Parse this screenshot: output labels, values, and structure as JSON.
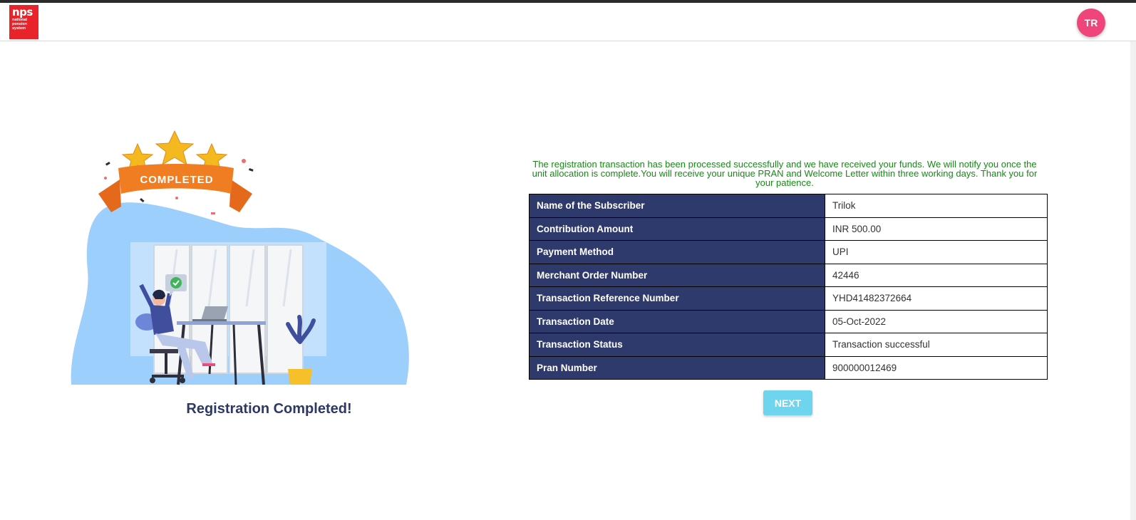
{
  "header": {
    "logo_main": "nps",
    "logo_lines": [
      "national",
      "pension",
      "system"
    ],
    "avatar_initials": "TR"
  },
  "illustration": {
    "banner_text": "COMPLETED"
  },
  "registration_title": "Registration Completed!",
  "message": "The registration transaction has been processed successfully and we have received your funds. We will notify you once the unit allocation is complete.You will receive your unique PRAN and Welcome Letter within three working days. Thank you for your patience.",
  "details": [
    {
      "label": "Name of the Subscriber",
      "value": "Trilok"
    },
    {
      "label": "Contribution Amount",
      "value": "INR 500.00"
    },
    {
      "label": "Payment Method",
      "value": "UPI"
    },
    {
      "label": "Merchant Order Number",
      "value": "42446"
    },
    {
      "label": "Transaction Reference Number",
      "value": "YHD41482372664"
    },
    {
      "label": "Transaction Date",
      "value": "05-Oct-2022"
    },
    {
      "label": "Transaction Status",
      "value": "Transaction successful"
    },
    {
      "label": "Pran Number",
      "value": "900000012469"
    }
  ],
  "next_label": "NEXT",
  "colors": {
    "brand_red": "#e8232a",
    "avatar_pink": "#f0457a",
    "table_header": "#2e3a6b",
    "message_green": "#168a16",
    "next_button": "#6fd5ee"
  }
}
